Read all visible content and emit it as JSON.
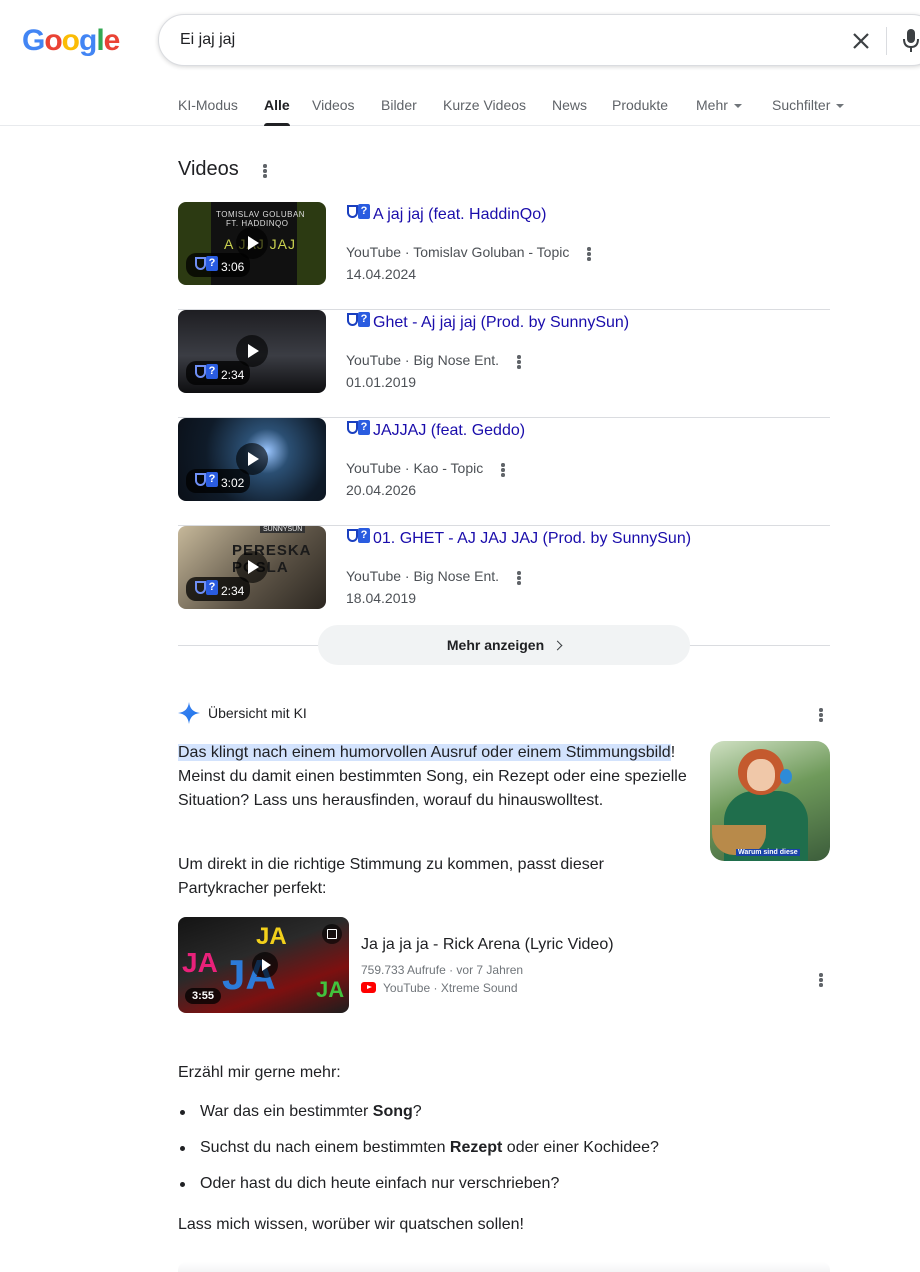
{
  "logo": {
    "letters": [
      "G",
      "o",
      "o",
      "g",
      "l",
      "e"
    ],
    "colors": [
      "#4285F4",
      "#EA4335",
      "#FBBC05",
      "#4285F4",
      "#34A853",
      "#EA4335"
    ]
  },
  "search": {
    "query": "Ei jaj jaj"
  },
  "tabs": [
    {
      "label": "KI-Modus"
    },
    {
      "label": "Alle"
    },
    {
      "label": "Videos"
    },
    {
      "label": "Bilder"
    },
    {
      "label": "Kurze Videos"
    },
    {
      "label": "News"
    },
    {
      "label": "Produkte"
    },
    {
      "label": "Mehr"
    },
    {
      "label": "Suchfilter"
    }
  ],
  "active_tab": "Alle",
  "videos": {
    "title": "Videos",
    "items": [
      {
        "title": "A jaj jaj (feat. HaddinQo)",
        "source": "YouTube · Tomislav Goluban - Topic",
        "date": "14.04.2024",
        "duration": "3:06",
        "thumb_text_top": "TOMISLAV GOLUBAN",
        "thumb_text_sub": "FT. HADDINQO",
        "thumb_text_main": "A JAJ JAJ"
      },
      {
        "title": "Ghet - Aj jaj jaj (Prod. by SunnySun)",
        "source": "YouTube · Big Nose Ent.",
        "date": "01.01.2019",
        "duration": "2:34"
      },
      {
        "title": "JAJJAJ (feat. Geddo)",
        "source": "YouTube · Kao - Topic",
        "date": "20.04.2026",
        "duration": "3:02"
      },
      {
        "title": "01. GHET - AJ JAJ JAJ (Prod. by SunnySun)",
        "source": "YouTube · Big Nose Ent.",
        "date": "18.04.2019",
        "duration": "2:34",
        "thumb_text_main": "PERESKA POSLA",
        "thumb_text_tag": "SUNNYSUN"
      }
    ],
    "more_label": "Mehr anzeigen"
  },
  "ai": {
    "heading": "Übersicht mit KI",
    "para1_highlight": "Das klingt nach einem humorvollen Ausruf oder einem Stimmungsbild",
    "para1_rest": "! Meinst du damit einen bestimmten Song, ein Rezept oder eine spezielle Situation? Lass uns herausfinden, worauf du hinauswolltest.",
    "para2": "Um direkt in die richtige Stimmung zu kommen, passt dieser Partykracher perfekt:",
    "image_caption": "Warum sind diese",
    "card": {
      "title": "Ja ja ja ja - Rick Arena (Lyric Video)",
      "meta": "759.733 Aufrufe · vor 7 Jahren",
      "source": "YouTube · Xtreme Sound",
      "duration": "3:55",
      "thumb_words": [
        "JA",
        "JA",
        "JA",
        "JA"
      ]
    },
    "prompt": "Erzähl mir gerne mehr:",
    "bullets": [
      {
        "pre": "War das ein bestimmter ",
        "bold": "Song",
        "post": "?"
      },
      {
        "pre": "Suchst du nach einem bestimmten ",
        "bold": "Rezept",
        "post": " oder einer Kochidee?"
      },
      {
        "pre": "Oder hast du dich heute einfach nur verschrieben?",
        "bold": "",
        "post": ""
      }
    ],
    "closing": "Lass mich wissen, worüber wir quatschen sollen!"
  }
}
